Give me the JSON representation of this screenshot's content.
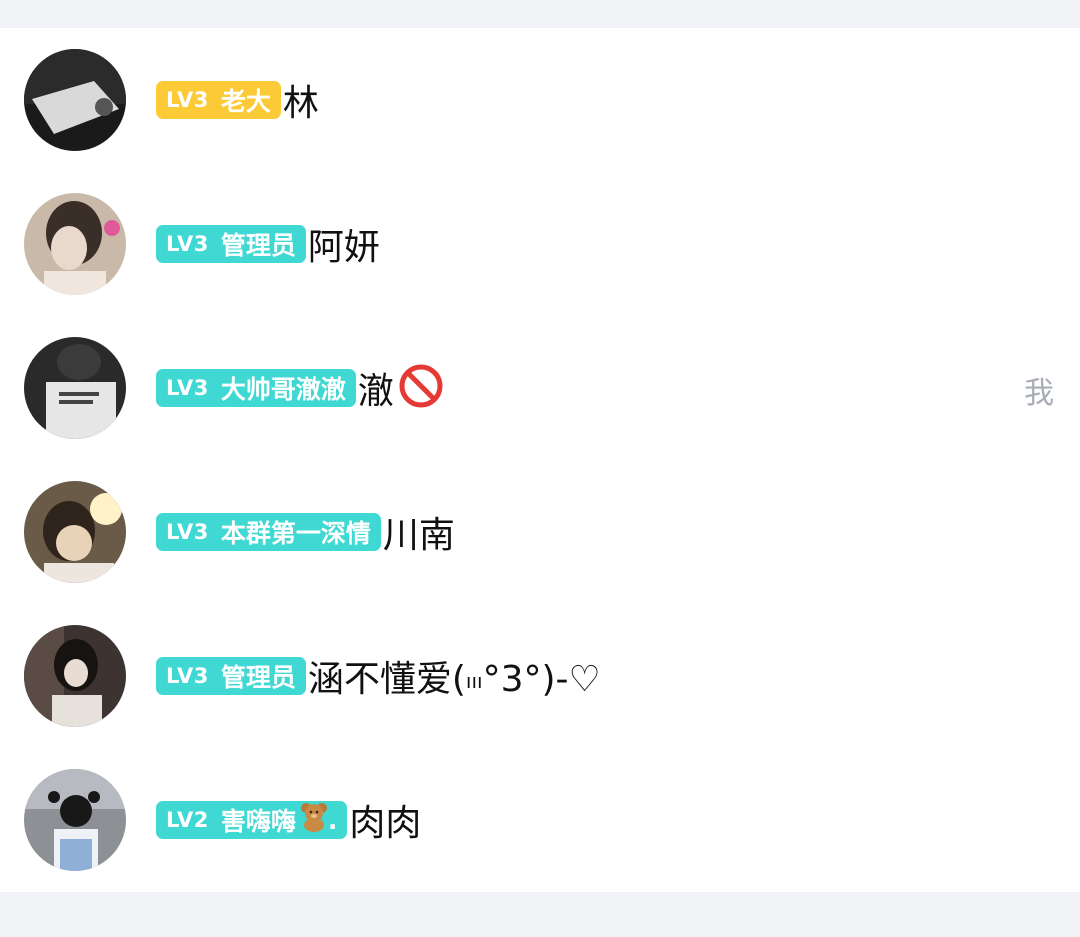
{
  "members": [
    {
      "level": "LV3",
      "title": "老大",
      "name": "林",
      "badge_color": "#fcc937",
      "self_tag": ""
    },
    {
      "level": "LV3",
      "title": "管理员",
      "name": "阿妍",
      "badge_color": "#3fd8d2",
      "self_tag": ""
    },
    {
      "level": "LV3",
      "title": "大帅哥澈澈",
      "name": "澈",
      "badge_color": "#3fd8d2",
      "self_tag": "我"
    },
    {
      "level": "LV3",
      "title": "本群第一深情",
      "name": "川南",
      "badge_color": "#3fd8d2",
      "self_tag": ""
    },
    {
      "level": "LV3",
      "title": "管理员",
      "name": "涵不懂爱(",
      "name_suffix": "°3°)-♡",
      "badge_color": "#3fd8d2",
      "self_tag": ""
    },
    {
      "level": "LV2",
      "title": "害嗨嗨",
      "title_suffix": ".",
      "name": "肉肉",
      "badge_color": "#3fd8d2",
      "self_tag": ""
    }
  ],
  "icons": {
    "ban": "prohibited-icon",
    "bear": "teddy-bear-icon"
  }
}
